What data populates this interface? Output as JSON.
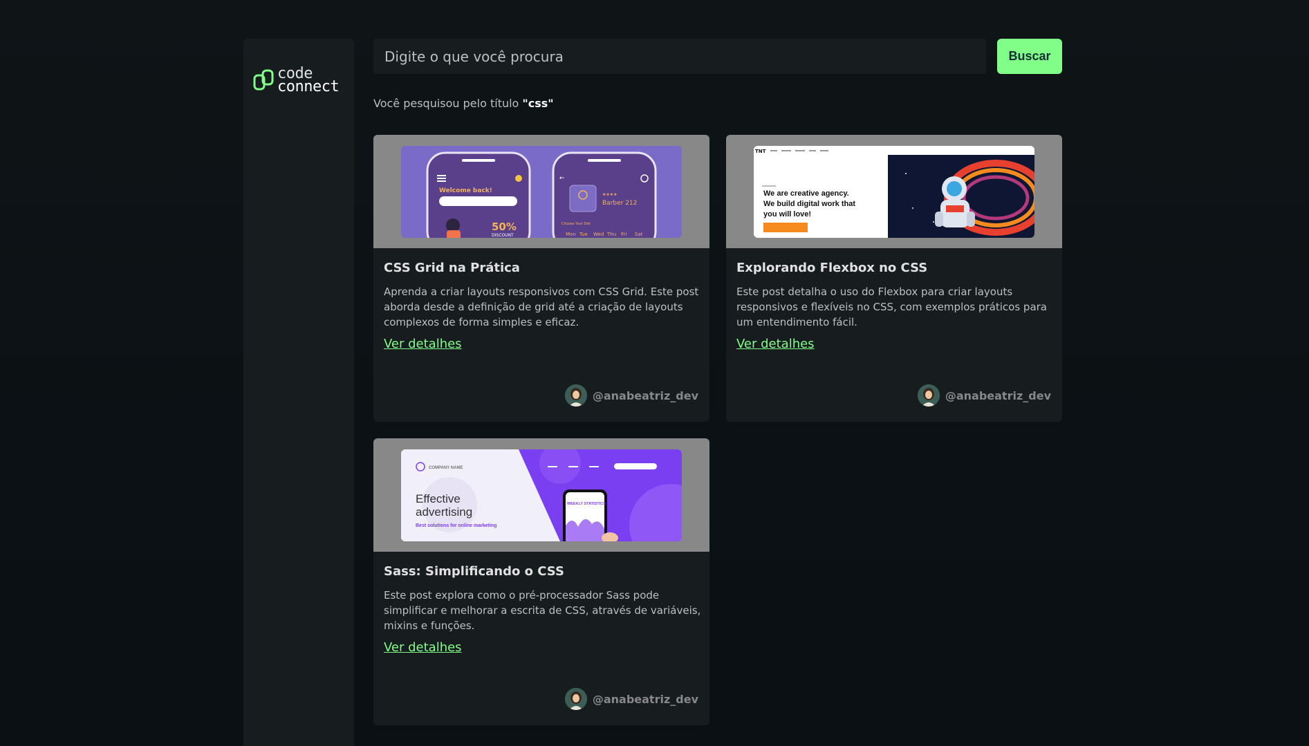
{
  "brand": {
    "line1": "code",
    "line2": "connect"
  },
  "search": {
    "placeholder": "Digite o que você procura",
    "button_label": "Buscar"
  },
  "result": {
    "prefix": "Você pesquisou pelo título ",
    "term": "\"css\""
  },
  "cards": [
    {
      "title": "CSS Grid na Prática",
      "description": "Aprenda a criar layouts responsivos com CSS Grid. Este post aborda desde a definição de grid até a criação de layouts complexos de forma simples e eficaz.",
      "link_label": "Ver detalhes",
      "author": "@anabeatriz_dev",
      "image": {
        "welcome": "Welcome back!",
        "discount": "50%",
        "discount_label": "DISCOUNT",
        "shop_name": "Barber 212",
        "choose": "Choose Your Slot",
        "days": [
          "Mon",
          "Tue",
          "Wed",
          "Thu",
          "Fri",
          "Sat"
        ]
      }
    },
    {
      "title": "Explorando Flexbox no CSS",
      "description": "Este post detalha o uso do Flexbox para criar layouts responsivos e flexíveis no CSS, com exemplos práticos para um entendimento fácil.",
      "link_label": "Ver detalhes",
      "author": "@anabeatriz_dev",
      "image": {
        "logo": "TNT",
        "headline_1": "We are creative agency.",
        "headline_2": "We build digital work that",
        "headline_3": "you will love!"
      }
    },
    {
      "title": "Sass: Simplificando o CSS",
      "description": "Este post explora como o pré-processador Sass pode simplificar e melhorar a escrita de CSS, através de variáveis, mixins e funções.",
      "link_label": "Ver detalhes",
      "author": "@anabeatriz_dev",
      "image": {
        "company": "COMPANY NAME",
        "headline_1": "Effective",
        "headline_2": "advertising",
        "tagline": "Best solutions for online marketing",
        "phone_label": "WEEKLY STATISTICS"
      }
    }
  ],
  "colors": {
    "background": "#0f1417",
    "panel": "#171d1f",
    "accent": "#81fe88",
    "media_bg": "#888888",
    "text": "#bcc0c1"
  }
}
